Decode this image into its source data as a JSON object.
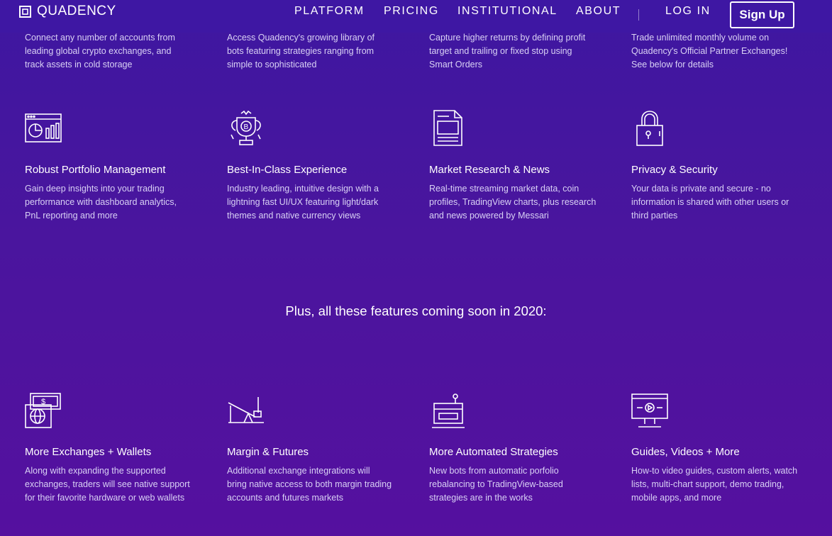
{
  "nav": {
    "brand": "QUADENCY",
    "links": [
      "PLATFORM",
      "PRICING",
      "INSTITUTIONAL",
      "ABOUT"
    ],
    "login": "LOG IN",
    "signup": "Sign Up"
  },
  "top_descriptions": [
    [
      "Connect any number of accounts from",
      "leading global crypto exchanges, and",
      "track assets in cold storage"
    ],
    [
      "Access Quadency's growing library of",
      "bots featuring strategies ranging from",
      "simple to sophisticated"
    ],
    [
      "Capture higher returns by defining profit",
      "target and trailing or fixed stop using",
      "Smart Orders"
    ],
    [
      "Trade unlimited monthly volume on",
      "Quadency's Official Partner Exchanges!",
      "See below for details"
    ]
  ],
  "features": [
    {
      "icon": "portfolio-chart-icon",
      "title": "Robust Portfolio Management",
      "desc": [
        "Gain deep insights into your trading",
        "performance with dashboard analytics,",
        "PnL reporting and more"
      ]
    },
    {
      "icon": "bitcoin-trophy-icon",
      "title": "Best-In-Class Experience",
      "desc": [
        "Industry leading, intuitive design with a",
        "lightning fast UI/UX featuring light/dark",
        "themes and native currency views"
      ]
    },
    {
      "icon": "document-news-icon",
      "title": "Market Research & News",
      "desc": [
        "Real-time streaming market data, coin",
        "profiles, TradingView charts, plus research",
        "and news powered by Messari"
      ]
    },
    {
      "icon": "padlock-icon",
      "title": "Privacy & Security",
      "desc": [
        "Your data is private and secure - no",
        "information is shared with other users or",
        "third parties"
      ]
    }
  ],
  "coming_soon_heading": "Plus, all these features coming soon in 2020:",
  "coming_features": [
    {
      "icon": "wallet-globe-icon",
      "title": "More Exchanges + Wallets",
      "desc": [
        "Along with expanding the supported",
        "exchanges, traders will see native support",
        "for their favorite hardware or web wallets"
      ]
    },
    {
      "icon": "margin-lever-icon",
      "title": "Margin & Futures",
      "desc": [
        "Additional exchange integrations will",
        "bring native access to both margin trading",
        "accounts and futures markets"
      ]
    },
    {
      "icon": "robot-bot-icon",
      "title": "More Automated Strategies",
      "desc": [
        "New bots from automatic porfolio",
        "rebalancing to TradingView-based",
        "strategies are in the works"
      ]
    },
    {
      "icon": "video-monitor-icon",
      "title": "Guides, Videos + More",
      "desc": [
        "How-to video guides, custom alerts, watch",
        "lists, multi-chart support, demo trading,",
        "mobile apps, and more"
      ]
    }
  ]
}
